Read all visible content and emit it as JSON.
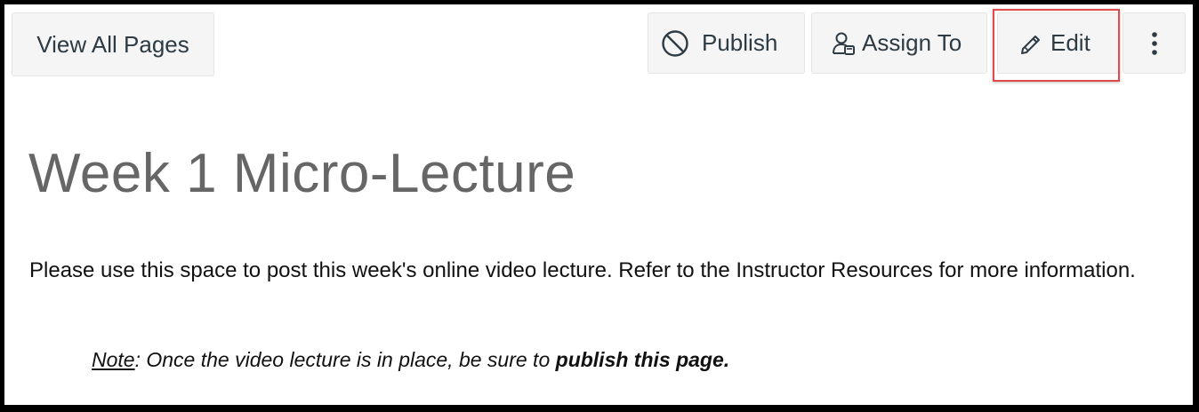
{
  "toolbar": {
    "view_all_pages_label": "View All Pages",
    "publish_label": "Publish",
    "assign_to_label": "Assign To",
    "edit_label": "Edit"
  },
  "icons": {
    "publish": "unpublished-circle-slash-icon",
    "assign_to": "assign-user-icon",
    "edit": "pencil-icon",
    "more": "kebab-menu-icon"
  },
  "colors": {
    "highlight_border": "#e04a4a",
    "button_bg": "#f5f5f5",
    "title_color": "#666666"
  },
  "page": {
    "title": "Week 1 Micro-Lecture",
    "body": "Please use this space to post this week's online video lecture.  Refer to the Instructor Resources for more information.",
    "note_label": "Note",
    "note_text": ": Once the video lecture is in place, be sure to ",
    "note_bold": "publish this page."
  }
}
